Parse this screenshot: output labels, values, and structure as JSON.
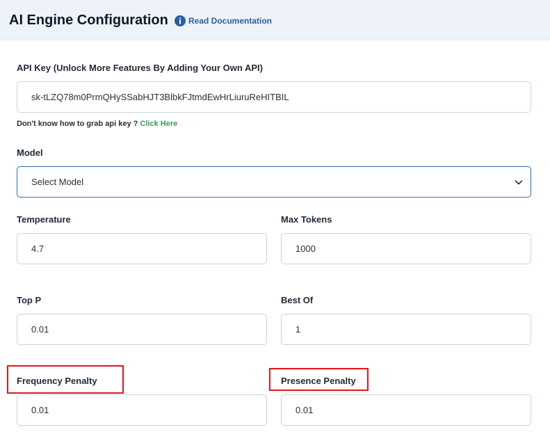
{
  "header": {
    "title": "AI Engine Configuration",
    "doc_link": "Read Documentation",
    "info_icon": "info-circle-icon"
  },
  "api_key": {
    "label": "API Key (Unlock More Features By Adding Your Own API)",
    "value": "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",
    "helper_text": "Don't know how to grab api key ?",
    "helper_link": "Click Here"
  },
  "model": {
    "label": "Model",
    "selected": "Select Model",
    "chevron_icon": "chevron-down-icon"
  },
  "temperature": {
    "label": "Temperature",
    "value": "4.7"
  },
  "max_tokens": {
    "label": "Max Tokens",
    "value": "1000"
  },
  "top_p": {
    "label": "Top P",
    "value": "0.01"
  },
  "best_of": {
    "label": "Best Of",
    "value": "1"
  },
  "frequency_penalty": {
    "label": "Frequency Penalty",
    "value": "0.01"
  },
  "presence_penalty": {
    "label": "Presence Penalty",
    "value": "0.01"
  },
  "colors": {
    "header_bg": "#eef3fa",
    "link_blue": "#2c5d9e",
    "link_green": "#3a9a4c",
    "focus_border": "#2e6fb6",
    "highlight_red": "#e3151a"
  }
}
